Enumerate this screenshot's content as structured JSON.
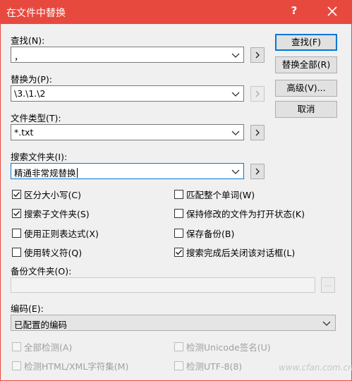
{
  "window": {
    "title": "在文件中替换",
    "help_label": "?"
  },
  "find": {
    "label": "查找(N):",
    "value": "，"
  },
  "replace": {
    "label": "替换为(P):",
    "value": "\\3.\\1.\\2"
  },
  "filetype": {
    "label": "文件类型(T):",
    "value": "*.txt"
  },
  "folder": {
    "label": "搜索文件夹(I):",
    "value": "精通非常规替换"
  },
  "buttons": {
    "find": "查找(F)",
    "replace_all": "替换全部(R)",
    "advanced": "高级(V)...",
    "cancel": "取消",
    "insert": ">",
    "browse": "..."
  },
  "options": {
    "match_case": {
      "label": "区分大小写(C)",
      "checked": true
    },
    "subfolders": {
      "label": "搜索子文件夹(S)",
      "checked": true
    },
    "regex": {
      "label": "使用正则表达式(X)",
      "checked": false
    },
    "escape": {
      "label": "使用转义符(Q)",
      "checked": false
    },
    "whole_word": {
      "label": "匹配整个单词(W)",
      "checked": false
    },
    "keep_open": {
      "label": "保持修改的文件为打开状态(K)",
      "checked": false
    },
    "backup": {
      "label": "保存备份(B)",
      "checked": false
    },
    "close_after": {
      "label": "搜索完成后关闭该对话框(L)",
      "checked": true
    }
  },
  "backup_folder": {
    "label": "备份文件夹(O):",
    "value": ""
  },
  "encoding": {
    "label": "编码(E):",
    "value": "已配置的编码",
    "detect_all": "全部检测(A)",
    "detect_html": "检测HTML/XML字符集(M)",
    "detect_unicode": "检测Unicode签名(U)",
    "detect_utf8": "检测UTF-8(8)"
  },
  "watermark": "www.cfan.com.cn"
}
